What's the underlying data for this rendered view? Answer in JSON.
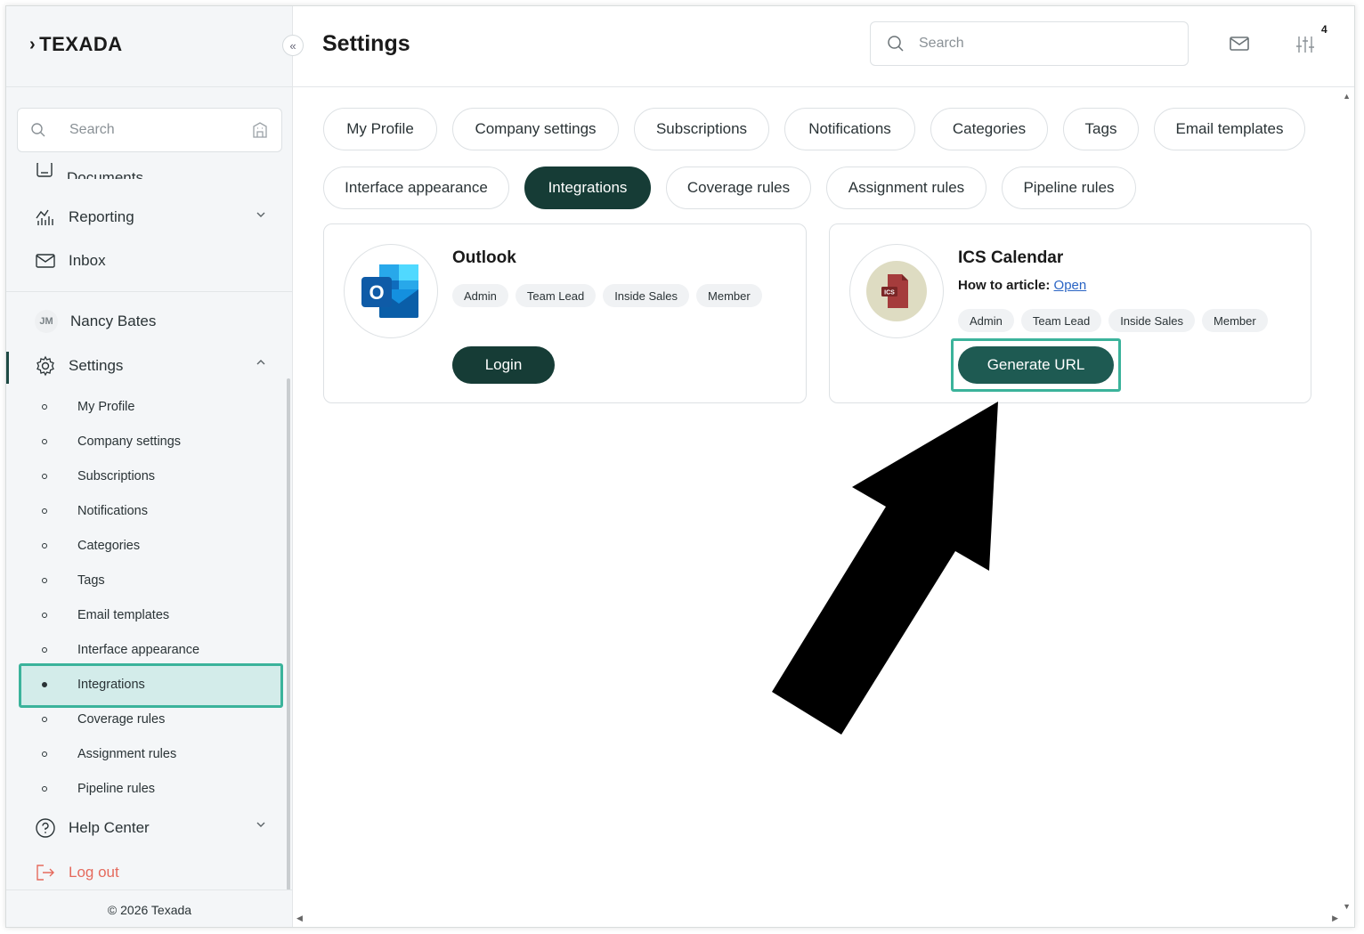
{
  "brand": {
    "name": "TEXADA"
  },
  "sidebar": {
    "search_placeholder": "Search",
    "cut_item": "Documents",
    "items": [
      {
        "label": "Reporting"
      },
      {
        "label": "Inbox"
      }
    ],
    "user": {
      "initials": "JM",
      "name": "Nancy Bates"
    },
    "settings": {
      "label": "Settings",
      "sub_items": [
        {
          "label": "My Profile"
        },
        {
          "label": "Company settings"
        },
        {
          "label": "Subscriptions"
        },
        {
          "label": "Notifications"
        },
        {
          "label": "Categories"
        },
        {
          "label": "Tags"
        },
        {
          "label": "Email templates"
        },
        {
          "label": "Interface appearance"
        },
        {
          "label": "Integrations"
        },
        {
          "label": "Coverage rules"
        },
        {
          "label": "Assignment rules"
        },
        {
          "label": "Pipeline rules"
        }
      ]
    },
    "help": "Help Center",
    "logout": "Log out",
    "footer": "© 2026 Texada"
  },
  "header": {
    "title": "Settings",
    "search_placeholder": "Search",
    "badge_count": "4"
  },
  "tabs": [
    {
      "label": "My Profile"
    },
    {
      "label": "Company settings"
    },
    {
      "label": "Subscriptions"
    },
    {
      "label": "Notifications"
    },
    {
      "label": "Categories"
    },
    {
      "label": "Tags"
    },
    {
      "label": "Email templates"
    },
    {
      "label": "Interface appearance"
    },
    {
      "label": "Integrations"
    },
    {
      "label": "Coverage rules"
    },
    {
      "label": "Assignment rules"
    },
    {
      "label": "Pipeline rules"
    }
  ],
  "integrations": {
    "outlook": {
      "title": "Outlook",
      "roles": [
        "Admin",
        "Team Lead",
        "Inside Sales",
        "Member"
      ],
      "button": "Login"
    },
    "ics": {
      "title": "ICS Calendar",
      "howto_label": "How to article:",
      "howto_link": "Open",
      "icon_text": "ICS",
      "roles": [
        "Admin",
        "Team Lead",
        "Inside Sales",
        "Member"
      ],
      "button": "Generate URL"
    }
  },
  "colors": {
    "accent_dark": "#163c36",
    "highlight": "#3bb39b",
    "logout": "#e56a5d"
  }
}
